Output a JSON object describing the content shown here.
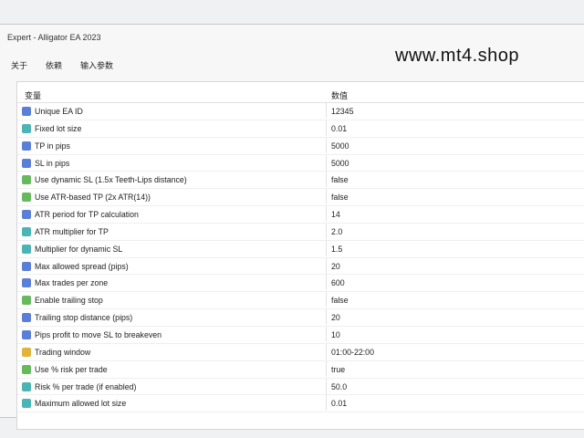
{
  "window": {
    "title": "Expert - Alligator EA 2023"
  },
  "tabs": [
    {
      "label": "关于"
    },
    {
      "label": "依赖"
    },
    {
      "label": "输入参数"
    }
  ],
  "watermark": "www.mt4.shop",
  "table": {
    "headers": {
      "name": "变量",
      "value": "数值"
    },
    "rows": [
      {
        "icon": "blue",
        "name": "Unique EA ID",
        "value": "12345"
      },
      {
        "icon": "teal",
        "name": "Fixed lot size",
        "value": "0.01"
      },
      {
        "icon": "blue",
        "name": "TP in pips",
        "value": "5000"
      },
      {
        "icon": "blue",
        "name": "SL in pips",
        "value": "5000"
      },
      {
        "icon": "green",
        "name": "Use dynamic SL (1.5x Teeth-Lips distance)",
        "value": "false"
      },
      {
        "icon": "green",
        "name": "Use ATR-based TP (2x ATR(14))",
        "value": "false"
      },
      {
        "icon": "blue",
        "name": "ATR period for TP calculation",
        "value": "14"
      },
      {
        "icon": "teal",
        "name": "ATR multiplier for TP",
        "value": "2.0"
      },
      {
        "icon": "teal",
        "name": "Multiplier for dynamic SL",
        "value": "1.5"
      },
      {
        "icon": "blue",
        "name": "Max allowed spread (pips)",
        "value": "20"
      },
      {
        "icon": "blue",
        "name": "Max trades per zone",
        "value": "600"
      },
      {
        "icon": "green",
        "name": "Enable trailing stop",
        "value": "false"
      },
      {
        "icon": "blue",
        "name": "Trailing stop distance (pips)",
        "value": "20"
      },
      {
        "icon": "blue",
        "name": "Pips profit to move SL to breakeven",
        "value": "10"
      },
      {
        "icon": "yellow",
        "name": "Trading window",
        "value": "01:00-22:00"
      },
      {
        "icon": "green",
        "name": "Use % risk per trade",
        "value": "true"
      },
      {
        "icon": "teal",
        "name": "Risk % per trade (if enabled)",
        "value": "50.0"
      },
      {
        "icon": "teal",
        "name": "Maximum allowed lot size",
        "value": "0.01"
      }
    ]
  }
}
